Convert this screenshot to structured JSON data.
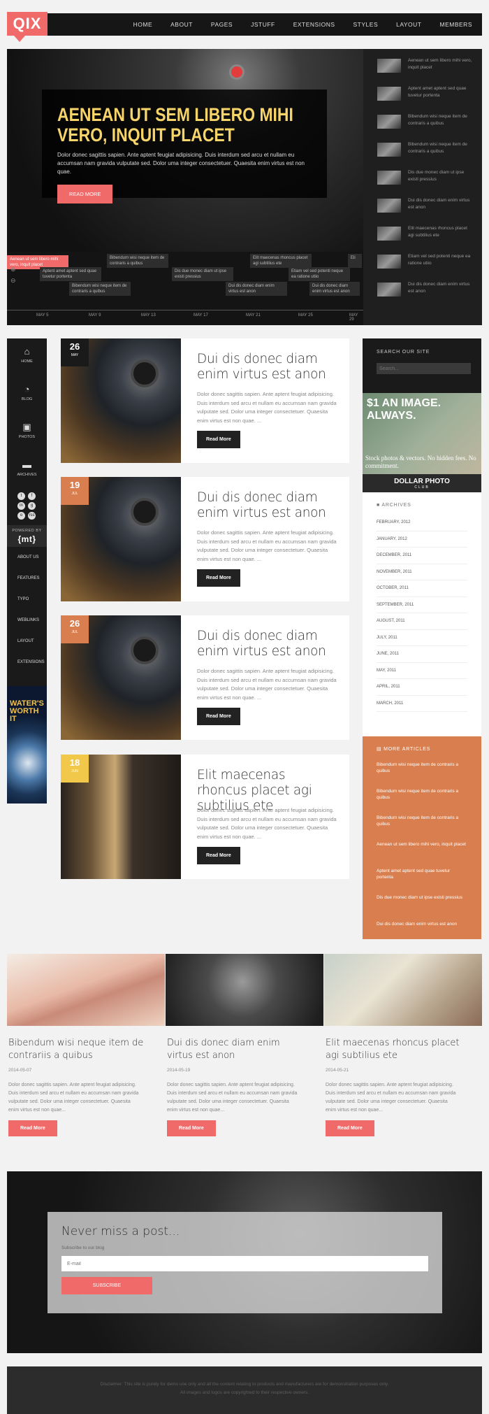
{
  "header": {
    "logo": "QIX",
    "nav": [
      "HOME",
      "ABOUT",
      "PAGES",
      "JSTUFF",
      "EXTENSIONS",
      "STYLES",
      "LAYOUT",
      "MEMBERS"
    ]
  },
  "hero": {
    "title": "AENEAN UT SEM LIBERO MIHI VERO, INQUIT PLACET",
    "text": "Dolor donec sagittis sapien. Ante aptent feugiat adipisicing. Duis interdum sed arcu et nullam eu accumsan nam gravida vulputate sed. Dolor uma integer consectetuer. Quaesita enim virtus est non quae.",
    "button": "READ MORE",
    "side": [
      "Aenean ut sem libero mihi vero, inquit placet",
      "Aptent amet aptent sed quae tuvetur portenta",
      "Bibendum wisi neque item de contraris a quibus",
      "Bibendum wisi neque item de contraris a quibus",
      "Dis due monec diam ut ipse existi pressius",
      "Dui dis donec diam enim virtus est anon",
      "Elit maecenas rhoncus placet agi subtilius ete",
      "Etiam vel sed potenti neque ea ratione utiio",
      "Dui dis donec diam enim virtus est anon"
    ]
  },
  "timeline": {
    "cards": [
      "Aenean ut sem libero mihi vero, inquit placet",
      "Aptent amet aptent sed quae tuvetur portenta",
      "Bibendum wisi neque item de contraris a quibus",
      "Bibendum wisi neque item de contraris a quibus",
      "Dis due monec diam ut ipse existi pressius",
      "Dui dis donec diam enim virtus est anon",
      "Elit maecenas rhoncus placet agi subtilius ete",
      "Etiam vel sed potenti neque ea ratione utiio",
      "Dui dis donec diam enim virtus est anon",
      "Eli"
    ],
    "dates": [
      "MAY 5",
      "MAY 9",
      "MAY 13",
      "MAY 17",
      "MAY 21",
      "MAY 25",
      "MAY 29"
    ]
  },
  "vnav": {
    "items": [
      "HOME",
      "BLOG",
      "PHOTOS",
      "ARCHIVES"
    ],
    "social": [
      "t",
      "f",
      "in",
      "g",
      "o",
      "rss"
    ],
    "powered": "POWERED BY",
    "powered_logo": "{mt}",
    "links": [
      "ABOUT US",
      "FEATURES",
      "TYPO",
      "WEBLINKS",
      "LAYOUT",
      "EXTENSIONS"
    ],
    "ad": "WATER'S WORTH IT"
  },
  "posts": [
    {
      "day": "26",
      "month": "MAY",
      "title": "Dui dis donec diam enim virtus est anon",
      "excerpt": "Dolor donec sagittis sapien. Ante aptent feugiat adipisicing. Duis interdum sed arcu et nullam eu accumsan nam gravida vulputate sed. Dolor uma integer consectetuer. Quaesita enim virtus est non quae. ...",
      "button": "Read More"
    },
    {
      "day": "19",
      "month": "JUL",
      "title": "Dui dis donec diam enim virtus est anon",
      "excerpt": "Dolor donec sagittis sapien. Ante aptent feugiat adipisicing. Duis interdum sed arcu et nullam eu accumsan nam gravida vulputate sed. Dolor uma integer consectetuer. Quaesita enim virtus est non quae. ...",
      "button": "Read More"
    },
    {
      "day": "26",
      "month": "JUL",
      "title": "Dui dis donec diam enim virtus est anon",
      "excerpt": "Dolor donec sagittis sapien. Ante aptent feugiat adipisicing. Duis interdum sed arcu et nullam eu accumsan nam gravida vulputate sed. Dolor uma integer consectetuer. Quaesita enim virtus est non quae. ...",
      "button": "Read More"
    },
    {
      "day": "18",
      "month": "JUN",
      "title": "Elit maecenas rhoncus placet agi subtilius ete",
      "excerpt": "Dolor donec sagittis sapien. Ante aptent feugiat adipisicing. Duis interdum sed arcu et nullam eu accumsan nam gravida vulputate sed. Dolor uma integer consectetuer. Quaesita enim virtus est non quae. ...",
      "button": "Read More"
    }
  ],
  "sidebar": {
    "search_label": "SEARCH OUR SITE",
    "search_placeholder": "Search...",
    "ad_head": "$1 AN IMAGE. ALWAYS.",
    "ad_sub": "Stock photos & vectors. No hidden fees. No commitment.",
    "ad_brand": "DOLLAR PHOTO",
    "ad_brand_sub": "CLUB",
    "archives_head": "ARCHIVES",
    "archives": [
      "FEBRUARY, 2012",
      "JANUARY, 2012",
      "DECEMBER, 2011",
      "NOVEMBER, 2011",
      "OCTOBER, 2011",
      "SEPTEMBER, 2011",
      "AUGUST, 2011",
      "JULY, 2011",
      "JUNE, 2011",
      "MAY, 2011",
      "APRIL, 2011",
      "MARCH, 2011"
    ],
    "more_head": "MORE ARTICLES",
    "more": [
      "Bibendum wisi neque item de contraris a quibus",
      "Bibendum wisi neque item de contraris a quibus",
      "Bibendum wisi neque item de contraris a quibus",
      "Aenean ut sem libero mihi vero, inquit placet",
      "Aptent amet aptent sed quae tuvetur portenta",
      "Dis due monec diam ut ipse existi pressius",
      "Dui dis donec diam enim virtus est anon"
    ]
  },
  "featured": [
    {
      "title": "Bibendum wisi neque item de contrariis a quibus",
      "date": "2014-05-07",
      "text": "Dolor donec sagittis sapien. Ante aptent feugiat adipisicing. Duis interdum sed arcu et nullam eu accumsan nam gravida vulputate sed. Dolor uma integer consectetuer. Quaesita enim virtus est non quae...",
      "button": "Read More"
    },
    {
      "title": "Dui dis donec diam enim virtus est anon",
      "date": "2014-05-19",
      "text": "Dolor donec sagittis sapien. Ante aptent feugiat adipisicing. Duis interdum sed arcu et nullam eu accumsan nam gravida vulputate sed. Dolor uma integer consectetuer. Quaesita enim virtus est non quae...",
      "button": "Read More"
    },
    {
      "title": "Elit maecenas rhoncus placet agi subtilius ete",
      "date": "2014-05-21",
      "text": "Dolor donec sagittis sapien. Ante aptent feugiat adipisicing. Duis interdum sed arcu et nullam eu accumsan nam gravida vulputate sed. Dolor uma integer consectetuer. Quaesita enim virtus est non quae...",
      "button": "Read More"
    }
  ],
  "newsletter": {
    "title": "Never miss a post...",
    "sub": "Subscribe to our blog",
    "placeholder": "E-mail",
    "button": "SUBSCRIBE"
  },
  "footer": {
    "line1": "Disclaimer: This site is purely for demo use only and all the content relating to products and manufacturers are for demonstration purposes only.",
    "line2": "All images and logos are copyrighted to their respective owners."
  },
  "colors": {
    "accent": "#f06a6a",
    "orange": "#d97f4f",
    "gold": "#f7d56a",
    "dark": "#1a1a1a"
  }
}
